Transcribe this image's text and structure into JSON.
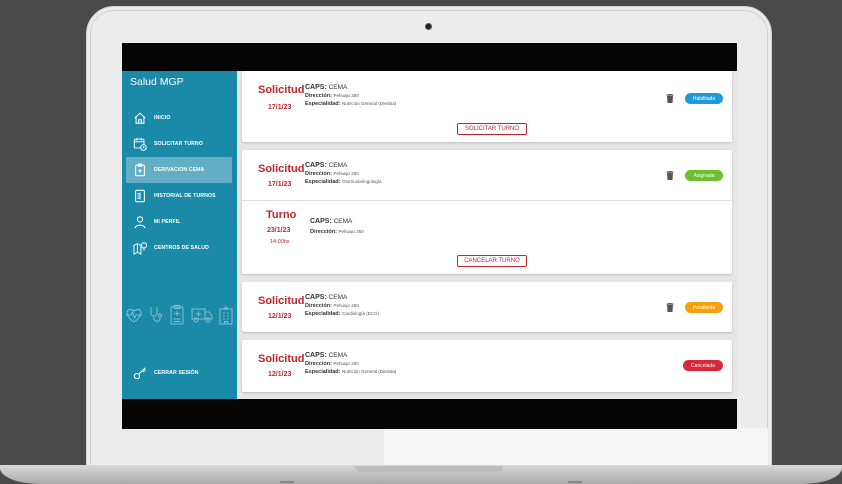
{
  "app": {
    "title": "Salud MGP"
  },
  "sidebar": {
    "items": [
      {
        "label": "INICIO",
        "icon": "home-icon"
      },
      {
        "label": "SOLICITAR TURNO",
        "icon": "calendar-clock-icon"
      },
      {
        "label": "DERIVACION CEMA",
        "icon": "clipboard-icon",
        "active": true
      },
      {
        "label": "HISTORIAL DE TURNOS",
        "icon": "history-list-icon"
      },
      {
        "label": "MI PERFIL",
        "icon": "user-icon"
      },
      {
        "label": "CENTROS DE SALUD",
        "icon": "map-pin-icon"
      }
    ],
    "logout": {
      "label": "CERRAR SESIÓN",
      "icon": "key-icon"
    },
    "decor_icons": [
      "heart-pulse-icon",
      "stethoscope-icon",
      "medical-record-icon",
      "ambulance-icon",
      "hospital-icon"
    ]
  },
  "cards": [
    {
      "kind": "Solicitud",
      "date": "17/1/23",
      "caps_label": "CAPS:",
      "caps": "CEMA",
      "dir_label": "Dirección:",
      "dir": "Pehuajo 250",
      "esp_label": "Especialidad:",
      "esp": "Nutrición General (Dietista)",
      "status": "Habilitada",
      "status_color": "#1e9bd7",
      "action": "SOLICITAR TURNO"
    },
    {
      "kind": "Solicitud",
      "date": "17/1/23",
      "caps_label": "CAPS:",
      "caps": "CEMA",
      "dir_label": "Dirección:",
      "dir": "Pehuajo 250",
      "esp_label": "Especialidad:",
      "esp": "Otorrinolaringología",
      "status": "Asignada",
      "status_color": "#6ec02e",
      "turno": {
        "kind": "Turno",
        "date": "23/1/23",
        "time": "14:00hs",
        "caps_label": "CAPS:",
        "caps": "CEMA",
        "dir_label": "Dirección:",
        "dir": "Pehuajo 250",
        "action": "CANCELAR TURNO"
      }
    },
    {
      "kind": "Solicitud",
      "date": "12/1/23",
      "caps_label": "CAPS:",
      "caps": "CEMA",
      "dir_label": "Dirección:",
      "dir": "Pehuajo 250",
      "esp_label": "Especialidad:",
      "esp": "Cardiología (ECG)",
      "status": "Pendiente",
      "status_color": "#f5a10c"
    },
    {
      "kind": "Solicitud",
      "date": "12/1/23",
      "caps_label": "CAPS:",
      "caps": "CEMA",
      "dir_label": "Dirección:",
      "dir": "Pehuajo 250",
      "esp_label": "Especialidad:",
      "esp": "Nutrición General (Dietista)",
      "status": "Cancelada",
      "status_color": "#d8283a"
    }
  ],
  "colors": {
    "sidebar": "#1b8aa8",
    "accent": "#c0262d",
    "active_item": "#63aec4"
  }
}
